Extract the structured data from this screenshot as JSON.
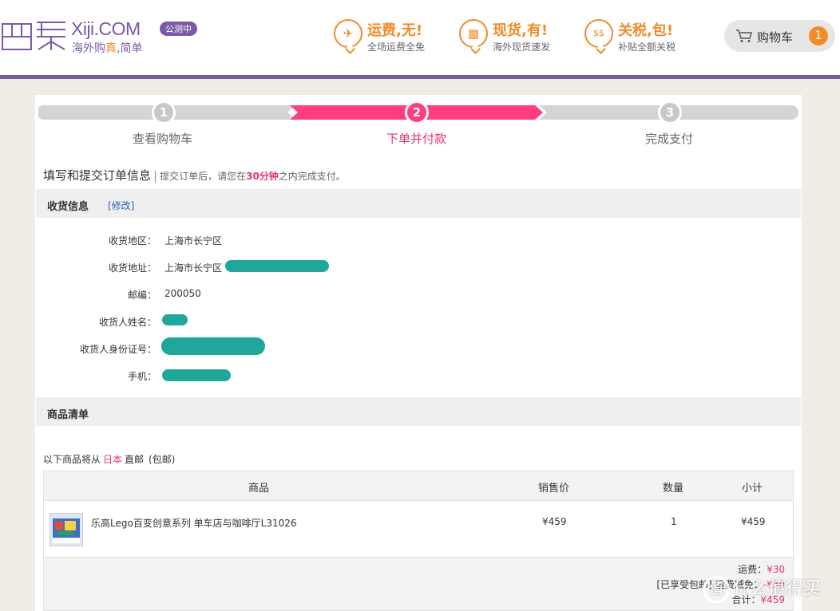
{
  "header": {
    "logo_en": "Xiji.COM",
    "logo_cn_a": "海外购",
    "logo_cn_b": "真",
    "logo_cn_c": ",简单",
    "beta_badge": "公测中",
    "promos": [
      {
        "icon": "airplane-icon",
        "title": "运费,无!",
        "subtitle": "全场运费全免"
      },
      {
        "icon": "gift-box-icon",
        "title": "现货,有!",
        "subtitle": "海外现货速发"
      },
      {
        "icon": "dollar-icon",
        "title": "关税,包!",
        "subtitle": "补贴全额关税"
      }
    ],
    "cart_label": "购物车",
    "cart_count": "1"
  },
  "steps": [
    {
      "num": "1",
      "label": "查看购物车"
    },
    {
      "num": "2",
      "label": "下单并付款"
    },
    {
      "num": "3",
      "label": "完成支付"
    }
  ],
  "intro": {
    "title": "填写和提交订单信息",
    "sep": "|",
    "note_a": "提交订单后，请您在",
    "note_b": "30分钟",
    "note_c": "之内完成支付。"
  },
  "shipping": {
    "title": "收货信息",
    "edit": "[修改]",
    "fields": [
      {
        "label": "收货地区：",
        "value": "上海市长宁区"
      },
      {
        "label": "收货地址：",
        "value": "上海市长宁区"
      },
      {
        "label": "邮编：",
        "value": "200050"
      },
      {
        "label": "收货人姓名：",
        "value": ""
      },
      {
        "label": "收货人身份证号：",
        "value": ""
      },
      {
        "label": "手机：",
        "value": ""
      }
    ]
  },
  "goods": {
    "title": "商品清单",
    "note_a": "以下商品将从",
    "note_country": "日本",
    "note_b": "直邮",
    "note_c": "(包邮)",
    "columns": [
      "商品",
      "销售价",
      "数量",
      "小计"
    ],
    "items": [
      {
        "name": "乐高Lego百变创意系列 单车店与咖啡厅L31026",
        "price": "¥459",
        "qty": "1",
        "subtotal": "¥459"
      }
    ],
    "summary": {
      "shipping_label": "运费：",
      "shipping_value": "¥30",
      "discount_tag": "[已享受包邮]",
      "discount_label": "运费减免：",
      "discount_value": "-¥30",
      "total_label": "合计：",
      "total_value": "¥459"
    }
  },
  "watermark": {
    "icon": "zhi-icon",
    "text": "什么值得买",
    "icon_char": "值"
  },
  "colors": {
    "brand_purple": "#7b5aa6",
    "accent_orange": "#f08c2a",
    "active_pink": "#ff3d7f",
    "redaction_teal": "#1fa89a"
  }
}
